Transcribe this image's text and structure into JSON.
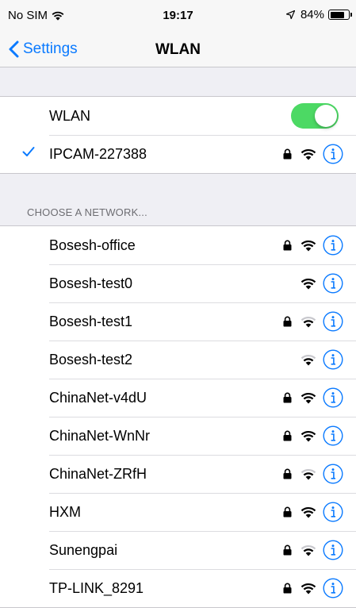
{
  "status_bar": {
    "carrier": "No SIM",
    "time": "19:17",
    "battery": "84%",
    "battery_level": 0.84
  },
  "nav": {
    "back_label": "Settings",
    "title": "WLAN"
  },
  "wlan_toggle": {
    "label": "WLAN",
    "on": true,
    "on_color": "#4cd964"
  },
  "connected": {
    "name": "IPCAM-227388",
    "locked": true,
    "signal": "full"
  },
  "section_header": "CHOOSE A NETWORK...",
  "networks": [
    {
      "name": "Bosesh-office",
      "locked": true,
      "signal": "full"
    },
    {
      "name": "Bosesh-test0",
      "locked": false,
      "signal": "full"
    },
    {
      "name": "Bosesh-test1",
      "locked": true,
      "signal": "weak"
    },
    {
      "name": "Bosesh-test2",
      "locked": false,
      "signal": "weak"
    },
    {
      "name": "ChinaNet-v4dU",
      "locked": true,
      "signal": "full"
    },
    {
      "name": "ChinaNet-WnNr",
      "locked": true,
      "signal": "full"
    },
    {
      "name": "ChinaNet-ZRfH",
      "locked": true,
      "signal": "weak"
    },
    {
      "name": "HXM",
      "locked": true,
      "signal": "full"
    },
    {
      "name": "Sunengpai",
      "locked": true,
      "signal": "weak"
    },
    {
      "name": "TP-LINK_8291",
      "locked": true,
      "signal": "full"
    }
  ],
  "colors": {
    "accent": "#0a7aff",
    "background": "#efeff4",
    "section_text": "#6d6d72"
  }
}
